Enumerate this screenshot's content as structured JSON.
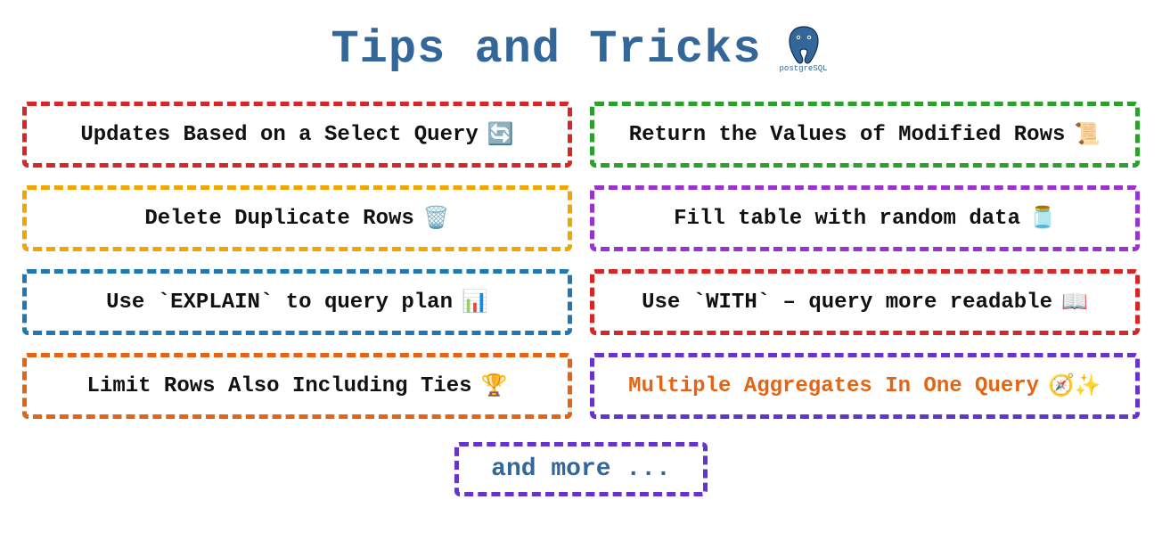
{
  "header": {
    "title": "Tips and Tricks",
    "logo_name": "postgresql-logo",
    "logo_caption": "postgreSQL"
  },
  "tips": [
    {
      "label": "Updates Based on a Select Query",
      "icon": "🔄",
      "icon_name": "refresh-icon",
      "border": "b-red",
      "text_class": ""
    },
    {
      "label": "Return the Values of Modified Rows",
      "icon": "📜",
      "icon_name": "scroll-icon",
      "border": "b-green",
      "text_class": ""
    },
    {
      "label": "Delete Duplicate Rows",
      "icon": "🗑️",
      "icon_name": "trash-icon",
      "border": "b-yellow",
      "text_class": ""
    },
    {
      "label": "Fill table with random data",
      "icon": "🫙",
      "icon_name": "jar-icon",
      "border": "b-purple",
      "text_class": ""
    },
    {
      "label": "Use `EXPLAIN` to query plan",
      "icon": "📊",
      "icon_name": "bar-chart-icon",
      "border": "b-blue",
      "text_class": ""
    },
    {
      "label": "Use `WITH` – query more readable",
      "icon": "📖",
      "icon_name": "book-icon",
      "border": "b-red",
      "text_class": ""
    },
    {
      "label": "Limit Rows Also Including Ties",
      "icon": "🏆",
      "icon_name": "trophy-icon",
      "border": "b-orange",
      "text_class": ""
    },
    {
      "label": "Multiple Aggregates In One Query",
      "icon": "🧭✨",
      "icon_name": "compass-sparkle-icon",
      "border": "b-violet",
      "text_class": "text-orange"
    }
  ],
  "footer": {
    "label": "and more ..."
  }
}
